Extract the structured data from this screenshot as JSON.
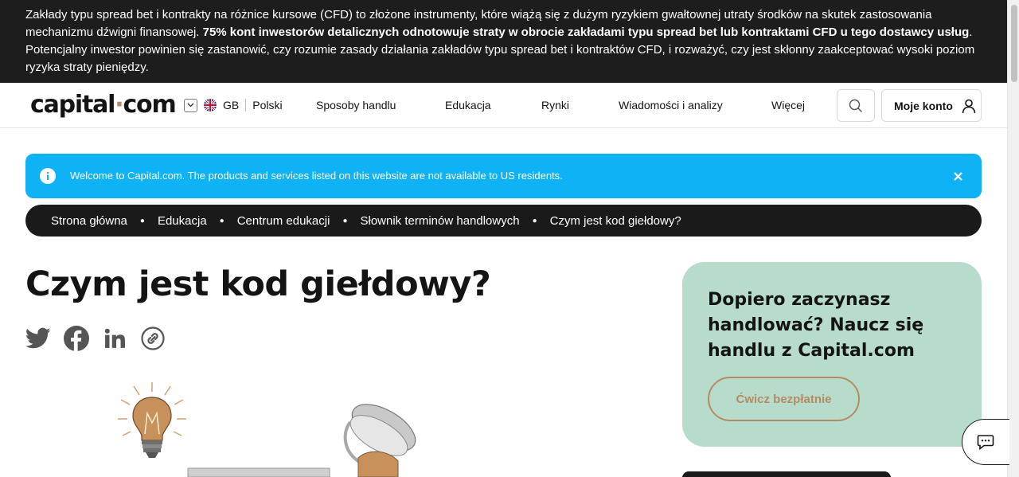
{
  "risk_warning": {
    "part1": "Zakłady typu spread bet i kontrakty na różnice kursowe (CFD) to złożone instrumenty, które wiążą się z dużym ryzykiem gwałtownej utraty środków na skutek zastosowania mechanizmu dźwigni finansowej. ",
    "bold": "75% kont inwestorów detalicznych odnotowuje straty w obrocie zakładami typu spread bet lub kontraktami CFD u tego dostawcy usług",
    "part2": ". Potencjalny inwestor powinien się zastanowić, czy rozumie zasady działania zakładów typu spread bet i kontraktów CFD, i rozważyć, czy jest skłonny zaakceptować wysoki poziom ryzyka straty pieniędzy."
  },
  "header": {
    "logo_left": "capital",
    "logo_dot": "·",
    "logo_right": "com",
    "region": "GB",
    "language": "Polski",
    "nav": [
      "Sposoby handlu",
      "Edukacja",
      "Rynki",
      "Wiadomości i analizy",
      "Więcej"
    ],
    "account_label": "Moje konto"
  },
  "info_banner": {
    "text": "Welcome to Capital.com. The products and services listed on this website are not available to US residents."
  },
  "breadcrumb": [
    "Strona główna",
    "Edukacja",
    "Centrum edukacji",
    "Słownik terminów handlowych",
    "Czym jest kod giełdowy?"
  ],
  "page": {
    "title": "Czym jest kod giełdowy?"
  },
  "social": [
    "twitter-icon",
    "facebook-icon",
    "linkedin-icon",
    "link-icon"
  ],
  "promo": {
    "title": "Dopiero zaczynasz handlować? Naucz się handlu z Capital.com",
    "cta": "Ćwicz bezpłatnie"
  },
  "colors": {
    "risk_bg": "#1d1d1d",
    "info_bg": "#10b2f6",
    "breadcrumb_bg": "#1a1a1a",
    "promo_bg": "#b8dccb",
    "accent": "#b58b66"
  }
}
